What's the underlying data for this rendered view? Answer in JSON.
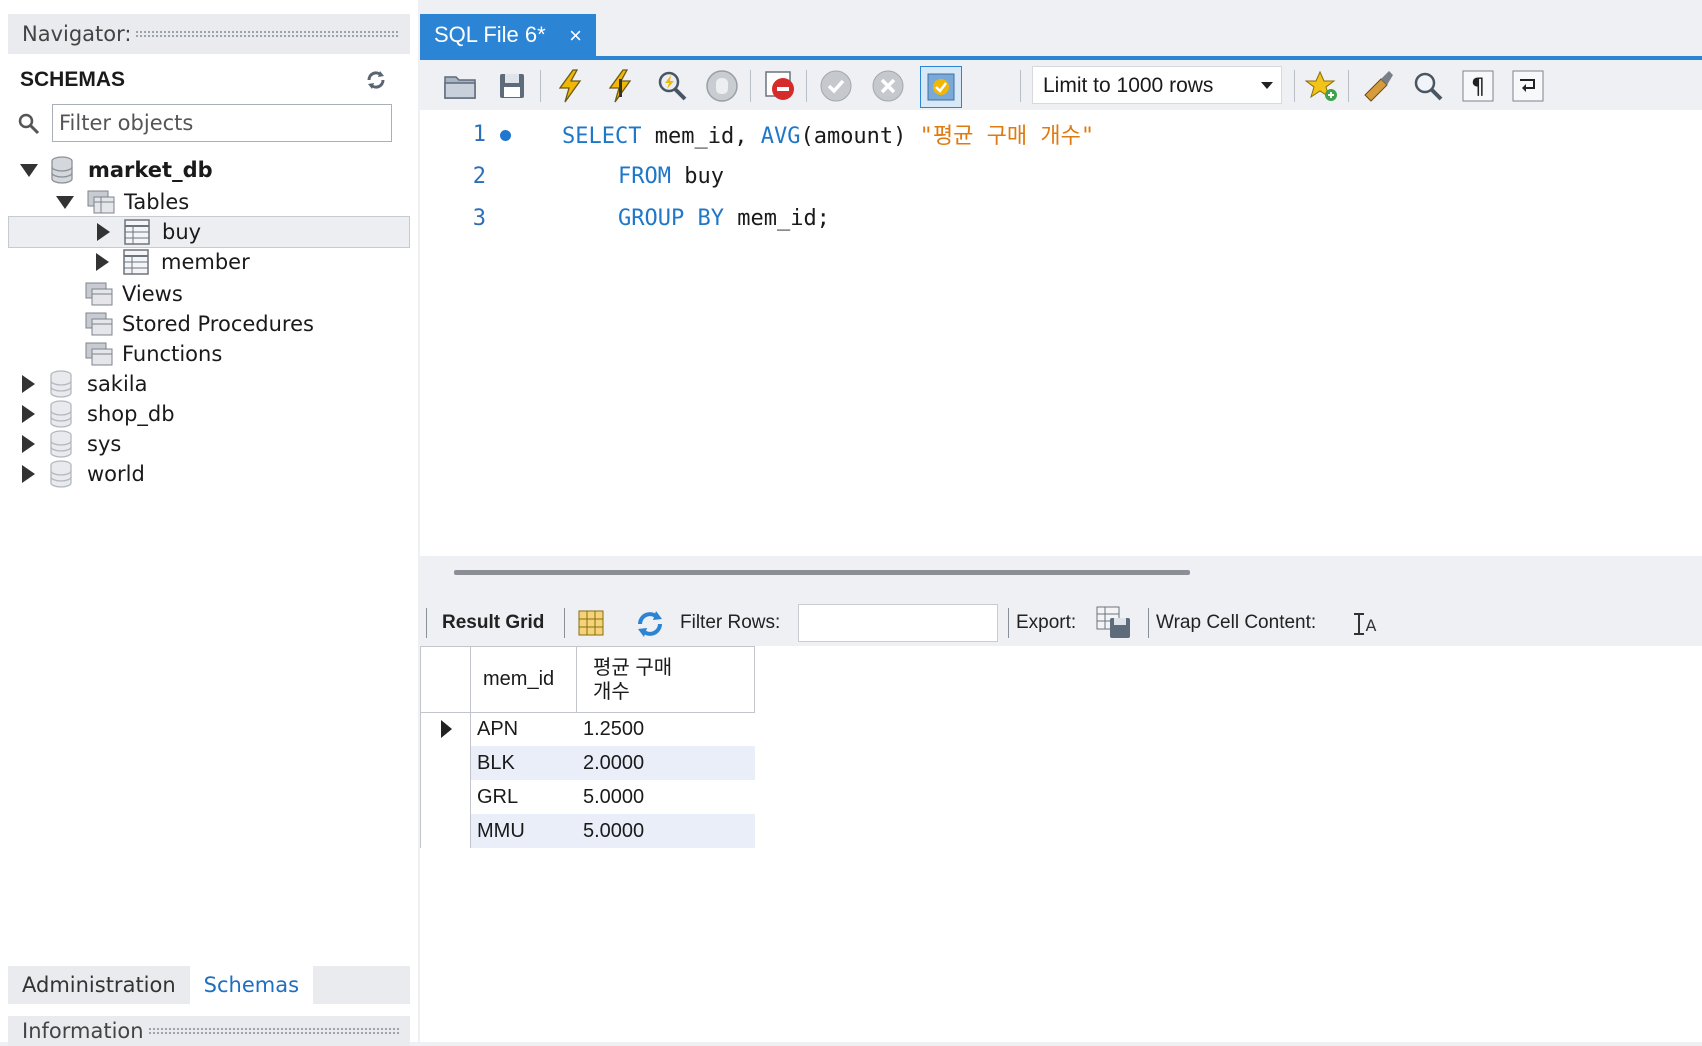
{
  "navigator": {
    "title": "Navigator:",
    "schemas_label": "SCHEMAS",
    "filter_placeholder": "Filter objects",
    "tree": {
      "market_db": "market_db",
      "tables": "Tables",
      "buy": "buy",
      "member": "member",
      "views": "Views",
      "stored_procedures": "Stored Procedures",
      "functions": "Functions",
      "sakila": "sakila",
      "shop_db": "shop_db",
      "sys": "sys",
      "world": "world"
    },
    "tabs": {
      "administration": "Administration",
      "schemas": "Schemas"
    },
    "information_title": "Information"
  },
  "editor": {
    "tab_label": "SQL File 6*",
    "tab_close": "×",
    "limit_label": "Limit to 1000 rows",
    "lines": [
      {
        "num": "1",
        "kw1": "SELECT",
        "t1": " mem_id, ",
        "kw2": "AVG",
        "t2": "(amount) ",
        "str": "\"평균 구매 개수\""
      },
      {
        "num": "2",
        "kw1": "FROM",
        "t1": " buy"
      },
      {
        "num": "3",
        "kw1": "GROUP BY",
        "t1": " mem_id;"
      }
    ]
  },
  "results": {
    "result_grid_label": "Result Grid",
    "filter_rows_label": "Filter Rows:",
    "export_label": "Export:",
    "wrap_label": "Wrap Cell Content:",
    "columns": [
      "mem_id",
      "평균 구매\n개수"
    ],
    "rows": [
      [
        "APN",
        "1.2500"
      ],
      [
        "BLK",
        "2.0000"
      ],
      [
        "GRL",
        "5.0000"
      ],
      [
        "MMU",
        "5.0000"
      ]
    ]
  }
}
